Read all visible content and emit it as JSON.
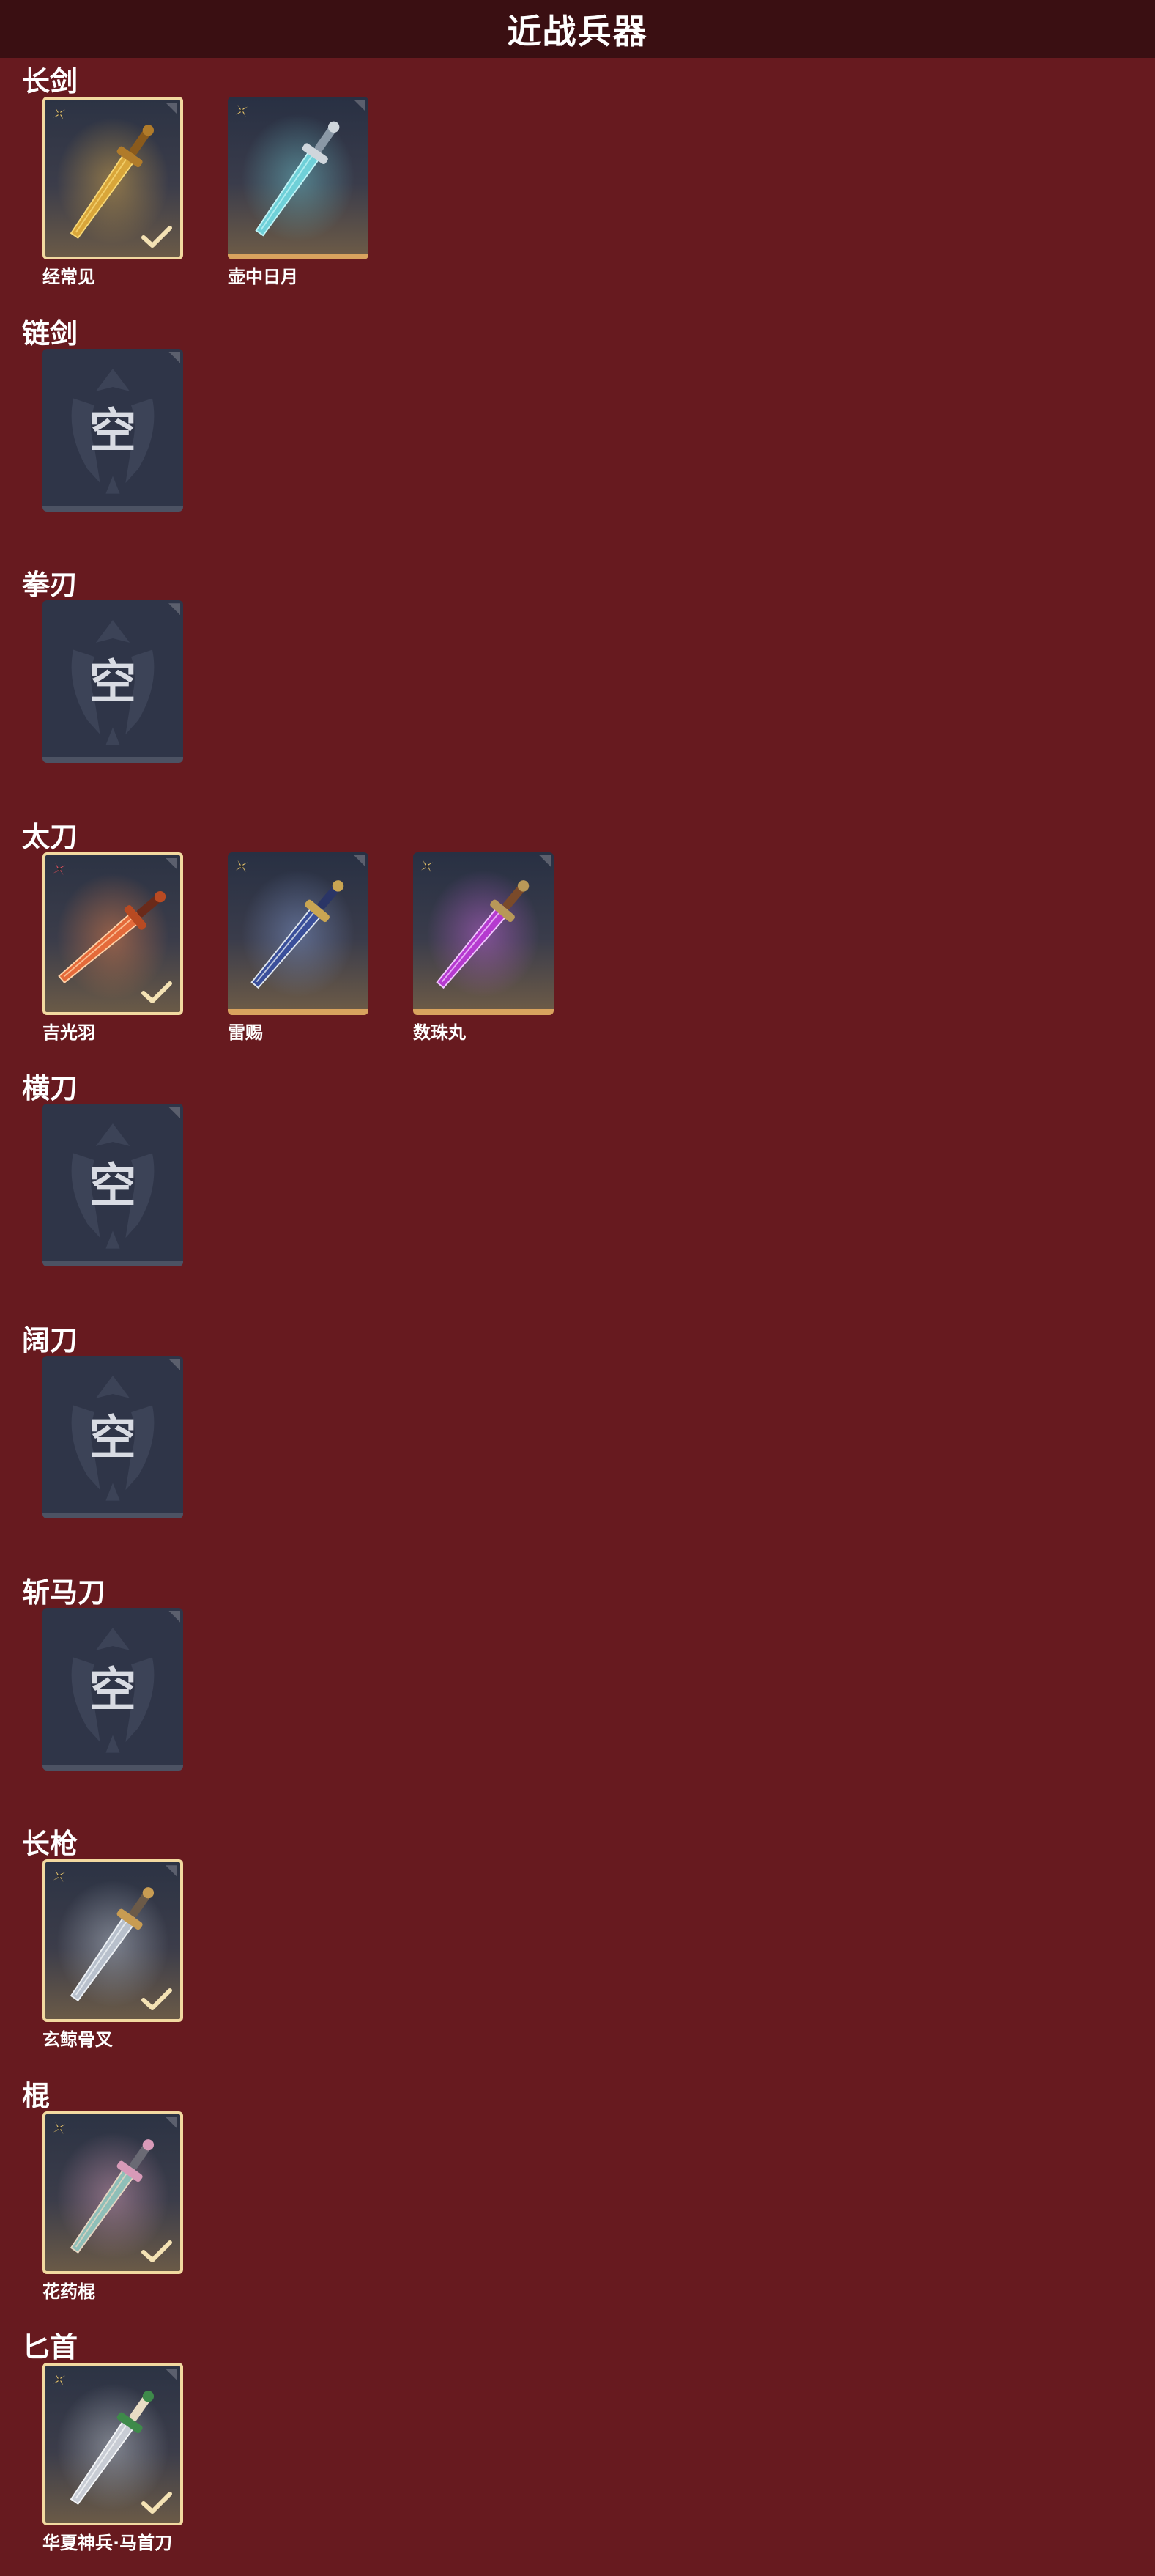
{
  "title": "近战兵器",
  "empty_label": "空",
  "categories": [
    {
      "name": "长剑",
      "items": [
        {
          "name": "经常见",
          "state": "equipped",
          "rarity": "gold"
        },
        {
          "name": "壶中日月",
          "state": "owned",
          "rarity": "gold"
        }
      ]
    },
    {
      "name": "链剑",
      "items": []
    },
    {
      "name": "拳刃",
      "items": []
    },
    {
      "name": "太刀",
      "items": [
        {
          "name": "吉光羽",
          "state": "equipped",
          "rarity": "red"
        },
        {
          "name": "雷赐",
          "state": "owned",
          "rarity": "gold"
        },
        {
          "name": "数珠丸",
          "state": "owned",
          "rarity": "gold"
        }
      ]
    },
    {
      "name": "横刀",
      "items": []
    },
    {
      "name": "阔刀",
      "items": []
    },
    {
      "name": "斩马刀",
      "items": []
    },
    {
      "name": "长枪",
      "items": [
        {
          "name": "玄鲸骨叉",
          "state": "equipped",
          "rarity": "gold"
        }
      ]
    },
    {
      "name": "棍",
      "items": [
        {
          "name": "花药棍",
          "state": "equipped",
          "rarity": "gold"
        }
      ]
    },
    {
      "name": "匕首",
      "items": [
        {
          "name": "华夏神兵·马首刀",
          "state": "equipped",
          "rarity": "gold"
        }
      ]
    }
  ],
  "colors": {
    "background": "#671a1f",
    "header": "#3a0f12",
    "equipped_border": "#f2d9a0",
    "owned_bar": "#d9a35e",
    "empty_card": "#2f3548",
    "rarity_gold": "#e6c36a",
    "rarity_red": "#e0505a"
  },
  "icons": {
    "rarity": "shuriken-rarity-icon",
    "equipped": "checkmark-icon",
    "empty": "emblem-icon"
  }
}
